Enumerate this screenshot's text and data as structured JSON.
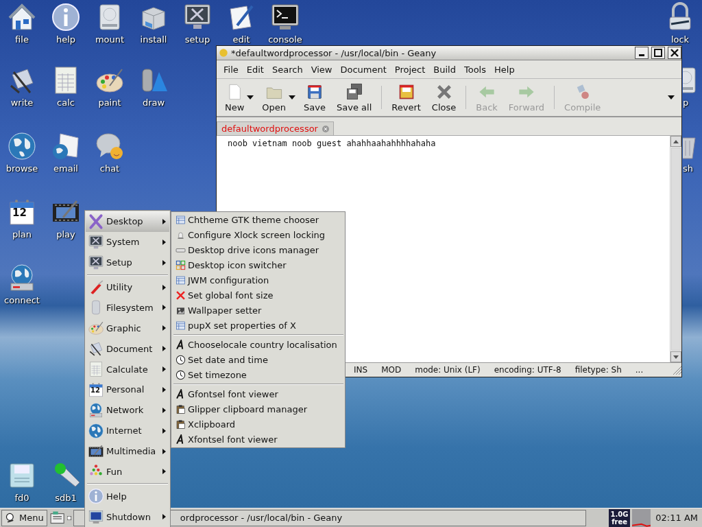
{
  "desktop_icons": [
    {
      "label": "file"
    },
    {
      "label": "help"
    },
    {
      "label": "mount"
    },
    {
      "label": "install"
    },
    {
      "label": "setup"
    },
    {
      "label": "edit"
    },
    {
      "label": "console"
    },
    {
      "label": "write"
    },
    {
      "label": "calc"
    },
    {
      "label": "paint"
    },
    {
      "label": "draw"
    },
    {
      "label": "browse"
    },
    {
      "label": "email"
    },
    {
      "label": "chat"
    },
    {
      "label": "plan",
      "icon_text": "12"
    },
    {
      "label": "play"
    },
    {
      "label": "connect"
    },
    {
      "label": "fd0"
    },
    {
      "label": "sdb1"
    },
    {
      "label": "lock"
    },
    {
      "label": "p"
    },
    {
      "label": "sh"
    }
  ],
  "window": {
    "title": "*defaultwordprocessor - /usr/local/bin - Geany",
    "menu": [
      "File",
      "Edit",
      "Search",
      "View",
      "Document",
      "Project",
      "Build",
      "Tools",
      "Help"
    ],
    "toolbar": [
      {
        "kind": "button",
        "label": "New",
        "dropdown": true,
        "disabled": false
      },
      {
        "kind": "button",
        "label": "Open",
        "dropdown": true,
        "disabled": false
      },
      {
        "kind": "button",
        "label": "Save",
        "dropdown": false,
        "disabled": false
      },
      {
        "kind": "button",
        "label": "Save all",
        "dropdown": false,
        "disabled": false
      },
      {
        "kind": "separator"
      },
      {
        "kind": "button",
        "label": "Revert",
        "dropdown": false,
        "disabled": false
      },
      {
        "kind": "button",
        "label": "Close",
        "dropdown": false,
        "disabled": false
      },
      {
        "kind": "separator"
      },
      {
        "kind": "button",
        "label": "Back",
        "dropdown": false,
        "disabled": true
      },
      {
        "kind": "button",
        "label": "Forward",
        "dropdown": false,
        "disabled": true
      },
      {
        "kind": "separator"
      },
      {
        "kind": "button",
        "label": "Compile",
        "dropdown": false,
        "disabled": true
      }
    ],
    "tab": {
      "label": "defaultwordprocessor",
      "modified": true
    },
    "editor_text": "noob vietnam noob guest ahahhaahahhhhahaha",
    "status": [
      "INS",
      "MOD",
      "mode: Unix (LF)",
      "encoding: UTF-8",
      "filetype: Sh",
      "..."
    ]
  },
  "main_menu": [
    {
      "kind": "item",
      "label": "Desktop",
      "submenu": true,
      "selected": true
    },
    {
      "kind": "item",
      "label": "System",
      "submenu": true,
      "selected": false
    },
    {
      "kind": "item",
      "label": "Setup",
      "submenu": true,
      "selected": false
    },
    {
      "kind": "separator"
    },
    {
      "kind": "item",
      "label": "Utility",
      "submenu": true,
      "selected": false
    },
    {
      "kind": "item",
      "label": "Filesystem",
      "submenu": true,
      "selected": false
    },
    {
      "kind": "item",
      "label": "Graphic",
      "submenu": true,
      "selected": false
    },
    {
      "kind": "item",
      "label": "Document",
      "submenu": true,
      "selected": false
    },
    {
      "kind": "item",
      "label": "Calculate",
      "submenu": true,
      "selected": false
    },
    {
      "kind": "item",
      "label": "Personal",
      "submenu": true,
      "selected": false,
      "icon_text": "12"
    },
    {
      "kind": "item",
      "label": "Network",
      "submenu": true,
      "selected": false
    },
    {
      "kind": "item",
      "label": "Internet",
      "submenu": true,
      "selected": false
    },
    {
      "kind": "item",
      "label": "Multimedia",
      "submenu": true,
      "selected": false
    },
    {
      "kind": "item",
      "label": "Fun",
      "submenu": true,
      "selected": false
    },
    {
      "kind": "separator"
    },
    {
      "kind": "item",
      "label": "Help",
      "submenu": false,
      "selected": false
    },
    {
      "kind": "item",
      "label": "Shutdown",
      "submenu": true,
      "selected": false
    }
  ],
  "submenu": [
    {
      "kind": "item",
      "label": "Chtheme GTK theme chooser"
    },
    {
      "kind": "item",
      "label": "Configure Xlock screen locking"
    },
    {
      "kind": "item",
      "label": "Desktop drive icons manager"
    },
    {
      "kind": "item",
      "label": "Desktop icon switcher"
    },
    {
      "kind": "item",
      "label": "JWM configuration"
    },
    {
      "kind": "item",
      "label": "Set global font size"
    },
    {
      "kind": "item",
      "label": "Wallpaper setter"
    },
    {
      "kind": "item",
      "label": "pupX set properties of X"
    },
    {
      "kind": "separator"
    },
    {
      "kind": "item",
      "label": "Chooselocale country localisation"
    },
    {
      "kind": "item",
      "label": "Set date and time"
    },
    {
      "kind": "item",
      "label": "Set timezone"
    },
    {
      "kind": "separator"
    },
    {
      "kind": "item",
      "label": "Gfontsel font viewer"
    },
    {
      "kind": "item",
      "label": "Glipper clipboard manager"
    },
    {
      "kind": "item",
      "label": "Xclipboard"
    },
    {
      "kind": "item",
      "label": "Xfontsel font viewer"
    }
  ],
  "taskbar": {
    "menu_button": "Menu",
    "task": "ordprocessor - /usr/local/bin - Geany",
    "memory": "1.0G free",
    "clock": "02:11 AM"
  }
}
